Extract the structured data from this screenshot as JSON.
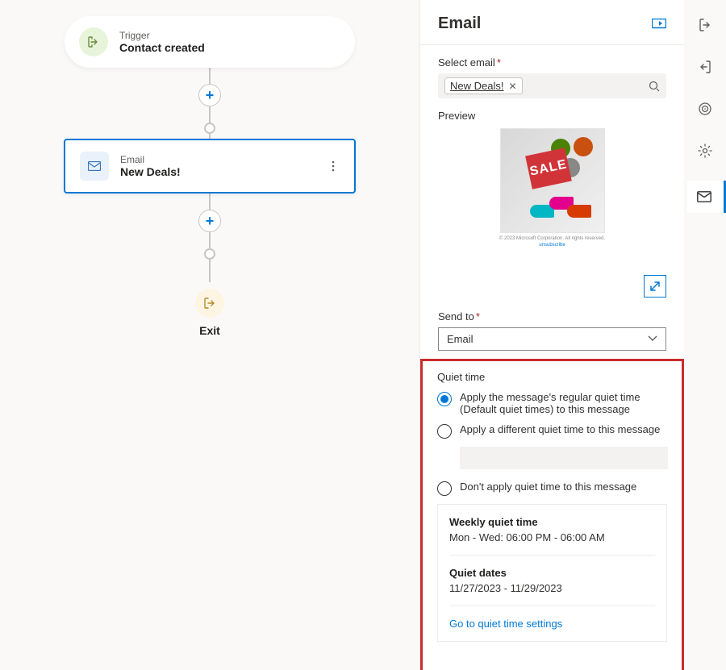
{
  "canvas": {
    "trigger": {
      "type_label": "Trigger",
      "title": "Contact created"
    },
    "email_tile": {
      "type_label": "Email",
      "title": "New Deals!"
    },
    "exit_label": "Exit"
  },
  "panel": {
    "title": "Email",
    "select_email_label": "Select email",
    "selected_email": "New Deals!",
    "preview_label": "Preview",
    "send_to_label": "Send to",
    "send_to_value": "Email",
    "quiet_time_label": "Quiet time",
    "radio_apply_regular": "Apply the message's regular quiet time (Default quiet times) to this message",
    "radio_apply_different": "Apply a different quiet time to this message",
    "radio_dont_apply": "Don't apply quiet time to this message",
    "weekly_header": "Weekly quiet time",
    "weekly_value": "Mon - Wed: 06:00 PM - 06:00 AM",
    "dates_header": "Quiet dates",
    "dates_value": "11/27/2023 - 11/29/2023",
    "settings_link": "Go to quiet time settings"
  },
  "rail": {
    "enter_icon": "enter-icon",
    "exit_icon": "exit-icon",
    "target_icon": "target-icon",
    "gear_icon": "gear-icon",
    "mail_icon": "mail-icon"
  }
}
